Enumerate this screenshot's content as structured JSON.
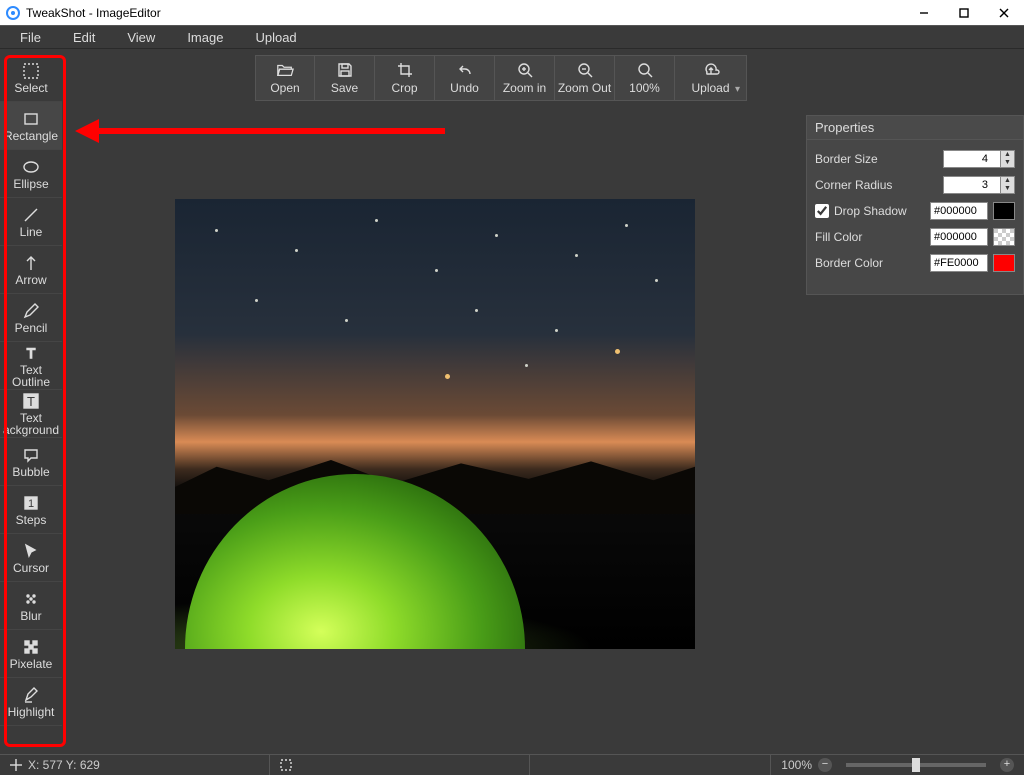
{
  "window": {
    "title": "TweakShot - ImageEditor"
  },
  "menu": [
    "File",
    "Edit",
    "View",
    "Image",
    "Upload"
  ],
  "tools": [
    {
      "id": "select",
      "label": "Select"
    },
    {
      "id": "rectangle",
      "label": "Rectangle"
    },
    {
      "id": "ellipse",
      "label": "Ellipse"
    },
    {
      "id": "line",
      "label": "Line"
    },
    {
      "id": "arrow",
      "label": "Arrow"
    },
    {
      "id": "pencil",
      "label": "Pencil"
    },
    {
      "id": "text-outline",
      "label": "Text\nOutline"
    },
    {
      "id": "text-background",
      "label": "Text\nackground"
    },
    {
      "id": "bubble",
      "label": "Bubble"
    },
    {
      "id": "steps",
      "label": "Steps"
    },
    {
      "id": "cursor",
      "label": "Cursor"
    },
    {
      "id": "blur",
      "label": "Blur"
    },
    {
      "id": "pixelate",
      "label": "Pixelate"
    },
    {
      "id": "highlight",
      "label": "Highlight"
    }
  ],
  "selected_tool": "rectangle",
  "topbar": {
    "open": "Open",
    "save": "Save",
    "crop": "Crop",
    "undo": "Undo",
    "zoom_in": "Zoom in",
    "zoom_out": "Zoom Out",
    "zoom_100": "100%",
    "upload": "Upload"
  },
  "properties": {
    "title": "Properties",
    "border_size_label": "Border Size",
    "border_size": "4",
    "corner_radius_label": "Corner Radius",
    "corner_radius": "3",
    "drop_shadow_label": "Drop Shadow",
    "drop_shadow_checked": true,
    "drop_shadow_color": "#000000",
    "fill_color_label": "Fill Color",
    "fill_color": "#000000",
    "border_color_label": "Border Color",
    "border_color": "#FE0000"
  },
  "status": {
    "coords": "X: 577 Y: 629",
    "zoom_pct": "100%"
  },
  "annotation": {
    "arrow_points_to": "rectangle-tool",
    "highlight_box": "left-toolbar"
  }
}
